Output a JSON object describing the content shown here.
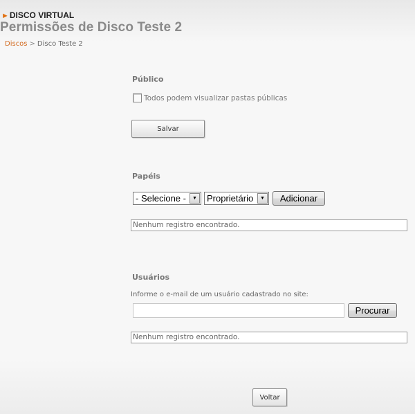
{
  "header": {
    "section": "DISCO VIRTUAL",
    "title": "Permissões de Disco Teste 2",
    "breadcrumb": {
      "link": "Discos",
      "separator": ">",
      "current": "Disco Teste 2"
    }
  },
  "publico": {
    "label": "Público",
    "checkbox_label": "Todos podem visualizar pastas públicas",
    "checked": false,
    "save_label": "Salvar"
  },
  "papeis": {
    "label": "Papéis",
    "select_user": "- Selecione -",
    "select_role": "Proprietário",
    "add_label": "Adicionar",
    "empty_text": "Nenhum registro encontrado."
  },
  "usuarios": {
    "label": "Usuários",
    "hint": "Informe o e-mail de um usuário cadastrado no site:",
    "email_value": "",
    "search_label": "Procurar",
    "empty_text": "Nenhum registro encontrado."
  },
  "footer": {
    "back_label": "Voltar"
  },
  "colors": {
    "accent": "#d2691e"
  }
}
